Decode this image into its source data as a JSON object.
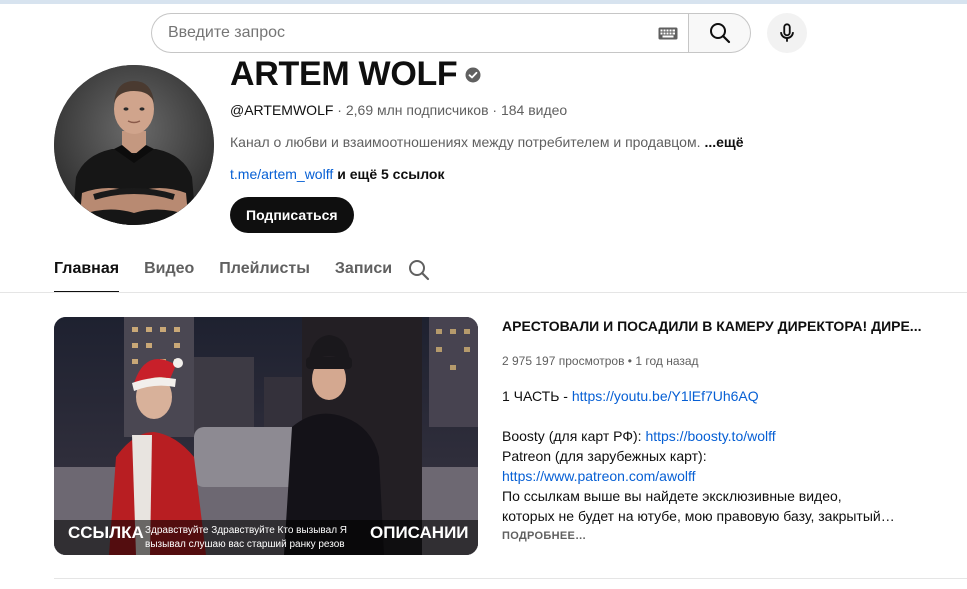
{
  "search": {
    "placeholder": "Введите запрос"
  },
  "channel": {
    "name": "ARTEM WOLF",
    "handle": "@ARTEMWOLF",
    "subscribers": "2,69 млн подписчиков",
    "videos": "184 видео",
    "separator": " · ",
    "description": "Канал о любви и взаимоотношениях между потребителем и продавцом.",
    "description_more": "...ещё",
    "link": "t.me/artem_wolff",
    "more_links": "и ещё 5 ссылок",
    "subscribe_label": "Подписаться"
  },
  "tabs": [
    {
      "label": "Главная",
      "active": true
    },
    {
      "label": "Видео",
      "active": false
    },
    {
      "label": "Плейлисты",
      "active": false
    },
    {
      "label": "Записи",
      "active": false
    }
  ],
  "featured_video": {
    "title": "АРЕСТОВАЛИ И ПОСАДИЛИ В КАМЕРУ ДИРЕКТОРА! ДИРЕ...",
    "views": "2 975 197 просмотров",
    "age": "1 год назад",
    "stats_sep": " • ",
    "thumb_left": "ССЫЛКА",
    "thumb_mid": "Здравствуйте Здравствуйте Кто вызывал Я вызывал слушаю вас старший ранку резов",
    "thumb_right": "ОПИСАНИИ",
    "desc_part1_text": "1 ЧАСТЬ - ",
    "desc_part1_link": "https://youtu.be/Y1lEf7Uh6AQ",
    "desc_boosty_text": "Boosty (для карт РФ): ",
    "desc_boosty_link": "https://boosty.to/wolff",
    "desc_patreon_text": "Patreon (для зарубежных карт):",
    "desc_patreon_link": "https://www.patreon.com/awolff",
    "desc_line_a": "По ссылкам выше вы найдете эксклюзивные видео,",
    "desc_line_b": "которых не будет на ютубе, мою правовую базу, закрытый…",
    "read_more": "ПОДРОБНЕЕ…"
  },
  "colors": {
    "link": "#065fd4",
    "primary_text": "#0f0f0f",
    "secondary_text": "#606060",
    "subscribe_bg": "#0f0f0f"
  },
  "icons": {
    "keyboard": "keyboard-icon",
    "search": "search-icon",
    "mic": "mic-icon",
    "verified": "verified-check-icon",
    "tab_search": "tab-search-icon"
  }
}
